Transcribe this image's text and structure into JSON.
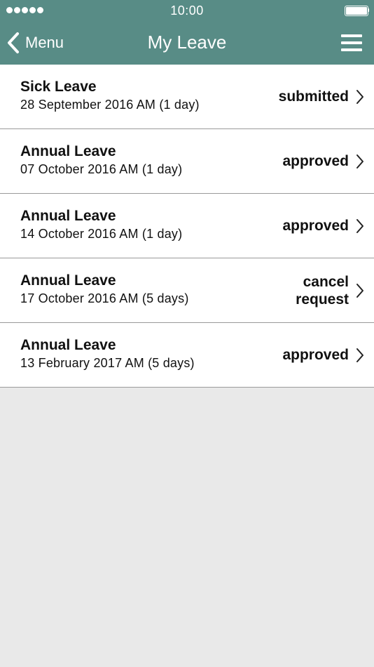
{
  "status_bar": {
    "time": "10:00",
    "signal_dots": 5,
    "battery_level": 1.0
  },
  "nav": {
    "back_label": "Menu",
    "title": "My Leave"
  },
  "leave_requests": [
    {
      "type": "Sick Leave",
      "date": "28 September 2016 AM (1 day)",
      "status": "submitted"
    },
    {
      "type": "Annual Leave",
      "date": "07 October 2016 AM (1 day)",
      "status": "approved"
    },
    {
      "type": "Annual Leave",
      "date": "14 October 2016 AM (1 day)",
      "status": "approved"
    },
    {
      "type": "Annual Leave",
      "date": "17 October 2016 AM (5 days)",
      "status": "cancel\nrequest"
    },
    {
      "type": "Annual Leave",
      "date": "13 February 2017 AM (5 days)",
      "status": "approved"
    }
  ],
  "icons": {
    "back": "chevron-left-icon",
    "menu": "hamburger-menu-icon",
    "disclosure": "chevron-right-icon",
    "battery": "battery-icon",
    "signal": "signal-dots-icon"
  },
  "colors": {
    "header_background": "#588c86",
    "header_text": "#ffffff",
    "list_background": "#ffffff",
    "page_background": "#e9e9e9",
    "divider": "#9a9a9a"
  }
}
